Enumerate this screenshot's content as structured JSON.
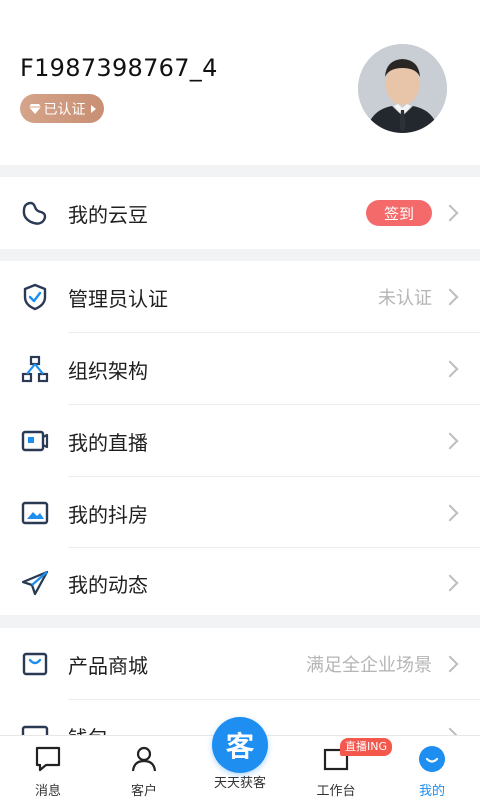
{
  "profile": {
    "username": "F1987398767_4",
    "cert_label": "已认证"
  },
  "menu": {
    "cloud_beans": {
      "label": "我的云豆",
      "action": "签到"
    },
    "admin_cert": {
      "label": "管理员认证",
      "value": "未认证"
    },
    "org": {
      "label": "组织架构"
    },
    "live": {
      "label": "我的直播"
    },
    "douyin_house": {
      "label": "我的抖房"
    },
    "moments": {
      "label": "我的动态"
    },
    "mall": {
      "label": "产品商城",
      "value": "满足全企业场景"
    },
    "wallet": {
      "label": "钱包"
    }
  },
  "tabbar": {
    "messages": "消息",
    "customers": "客户",
    "center": "天天获客",
    "center_glyph": "客",
    "workbench": "工作台",
    "workbench_badge": "直播ING",
    "mine": "我的"
  },
  "colors": {
    "accent": "#1e8ef0",
    "signin": "#f46a6a",
    "cert_badge": "#d5a48a",
    "live_badge": "#f4584c"
  },
  "icons": {
    "cloud_beans": "bean-icon",
    "admin_cert": "shield-check-icon",
    "org": "org-chart-icon",
    "live": "live-camera-icon",
    "douyin_house": "image-icon",
    "moments": "paper-plane-icon",
    "mall": "shopping-bag-icon",
    "wallet": "wallet-icon"
  }
}
